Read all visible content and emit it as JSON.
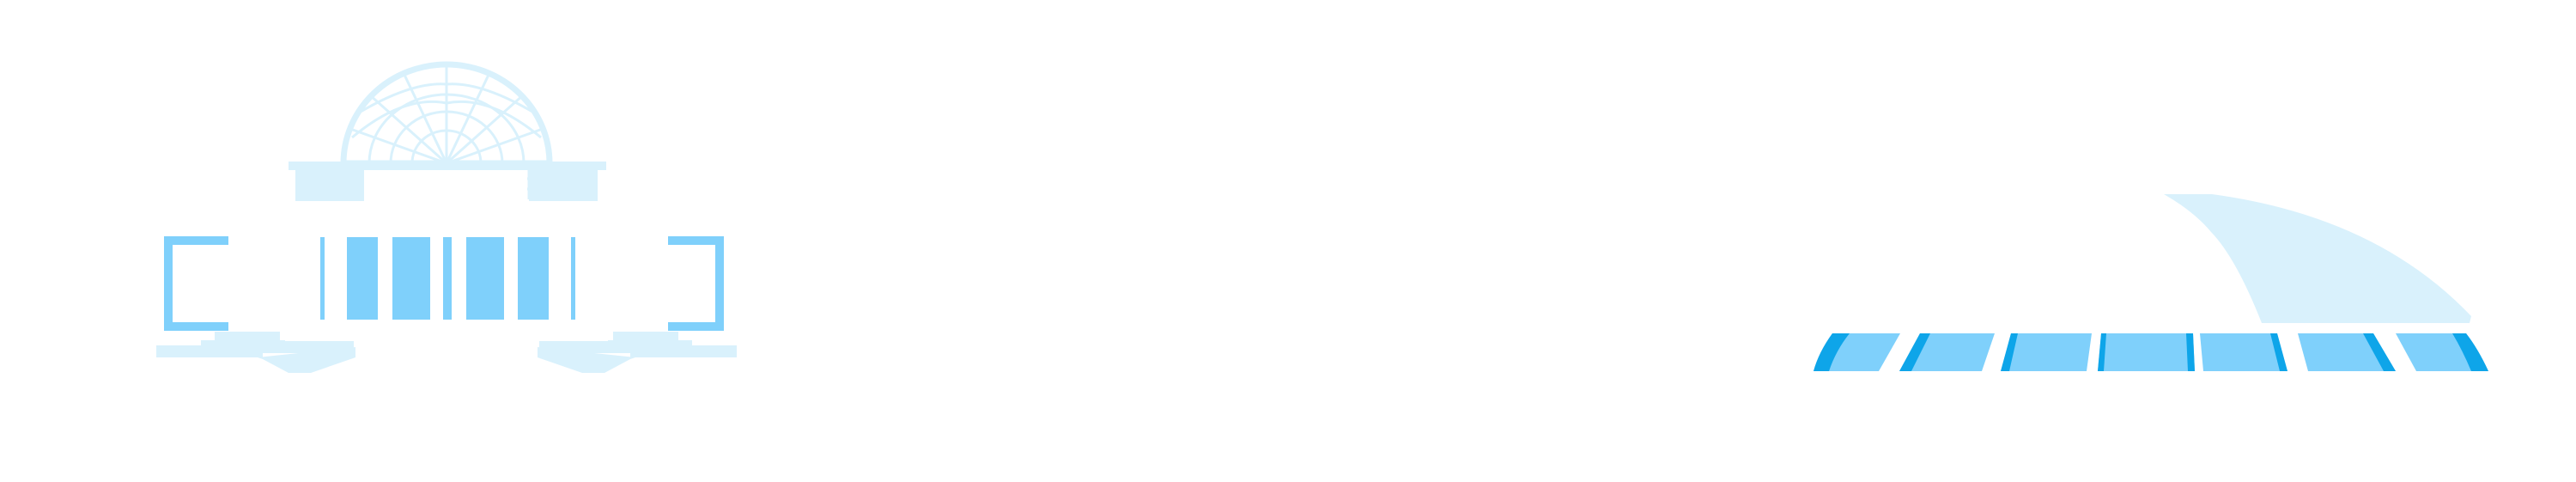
{
  "colors": {
    "background": "#ffffff",
    "primary_light": "#7fd0fb",
    "secondary_light": "#d9f1fc",
    "accent": "#0ea5e9"
  },
  "illustrations": [
    {
      "name": "domed-pavilion-illustration",
      "icon": "domed-building-icon"
    },
    {
      "name": "sail-roof-stadium-illustration",
      "icon": "stadium-icon"
    }
  ]
}
